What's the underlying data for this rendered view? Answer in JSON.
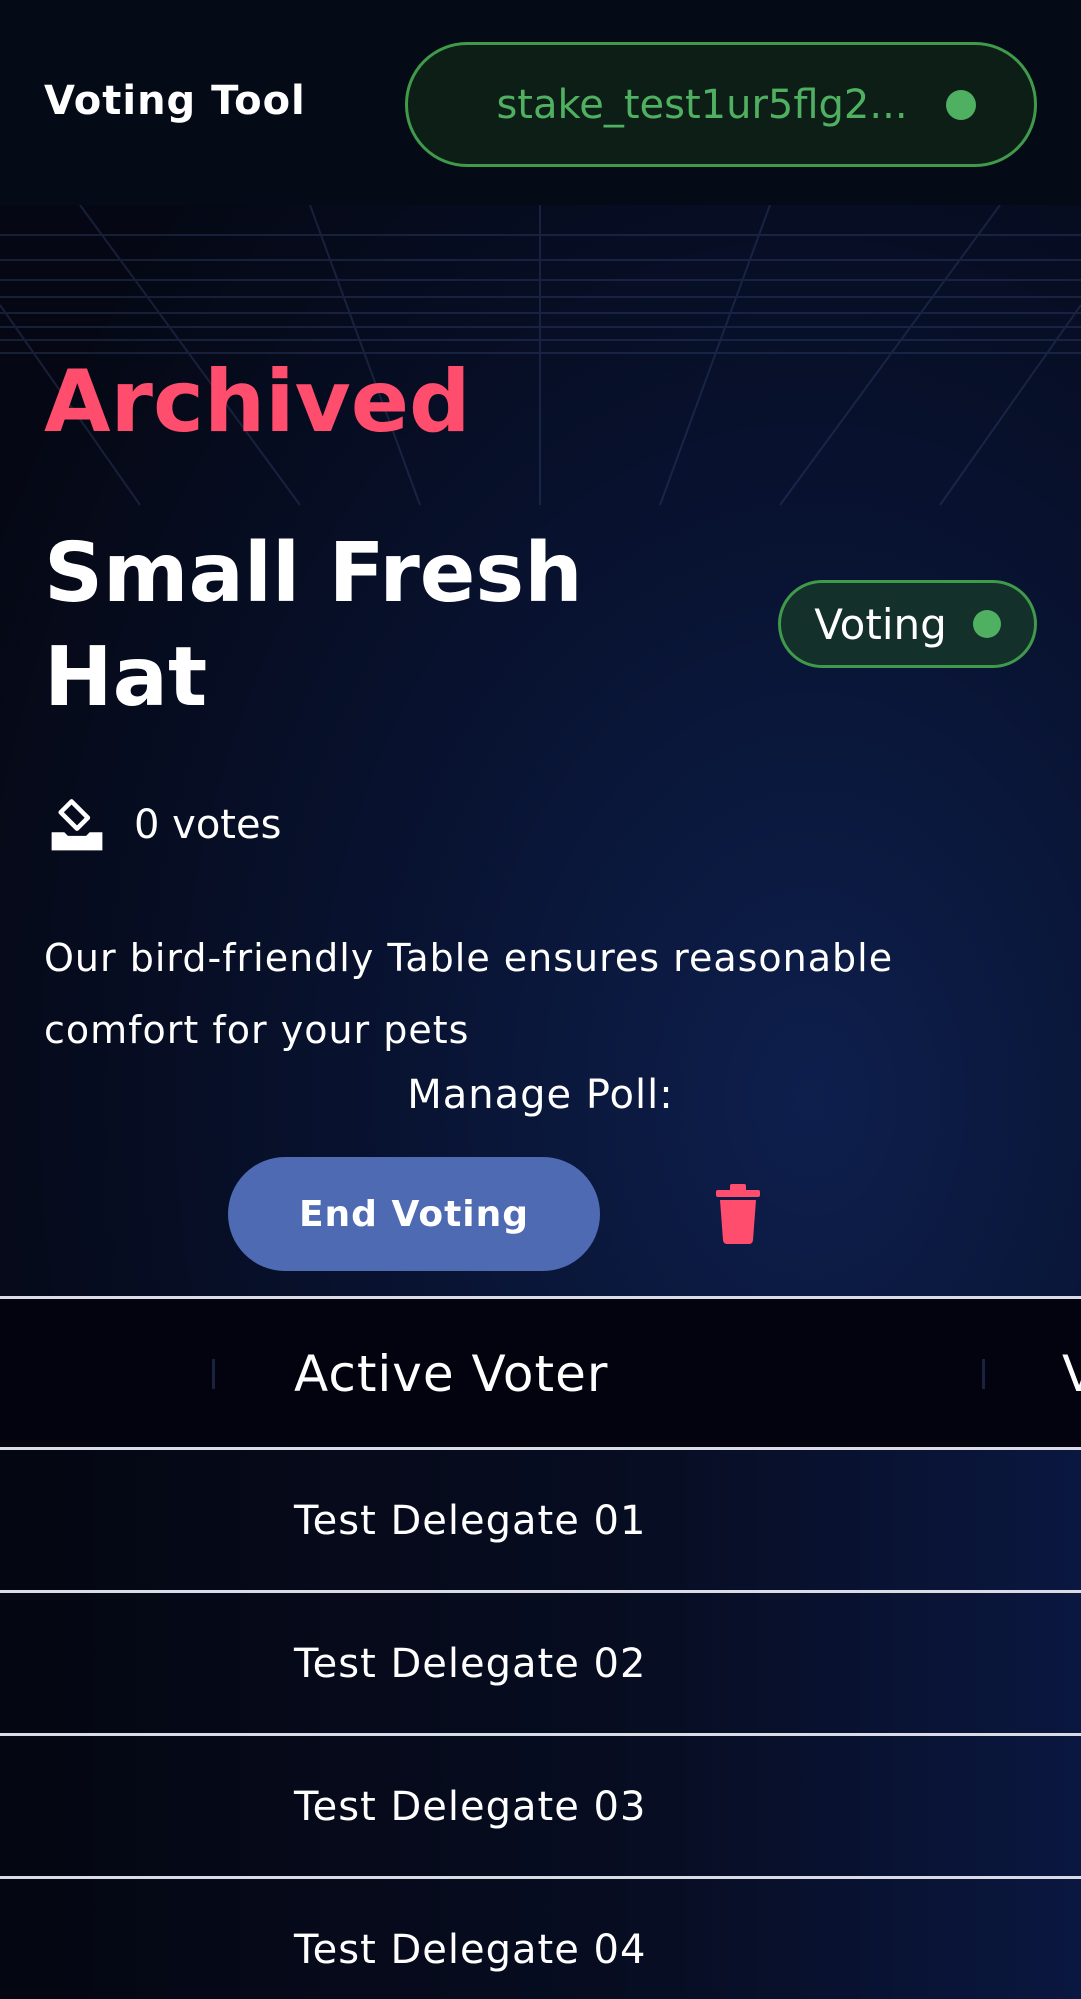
{
  "header": {
    "app_title": "Voting Tool",
    "wallet_address": "stake_test1ur5flg2...",
    "wallet_status_color": "#4fb062"
  },
  "poll": {
    "archived_label": "Archived",
    "title": "Small Fresh Hat",
    "status": "Voting",
    "votes_icon": "ballot-box-icon",
    "votes_text": "0 votes",
    "description": "Our bird-friendly Table ensures reasonable comfort for your pets",
    "manage_label": "Manage Poll:",
    "end_voting_label": "End Voting",
    "delete_icon": "trash-icon"
  },
  "colors": {
    "accent_red": "#ff4d6d",
    "accent_green": "#4fb062",
    "button_blue": "#4e6ab3"
  },
  "table": {
    "columns": [
      "Active Voter",
      "V"
    ],
    "rows": [
      {
        "voter": "Test Delegate 01"
      },
      {
        "voter": "Test Delegate 02"
      },
      {
        "voter": "Test Delegate 03"
      },
      {
        "voter": "Test Delegate 04"
      }
    ]
  }
}
